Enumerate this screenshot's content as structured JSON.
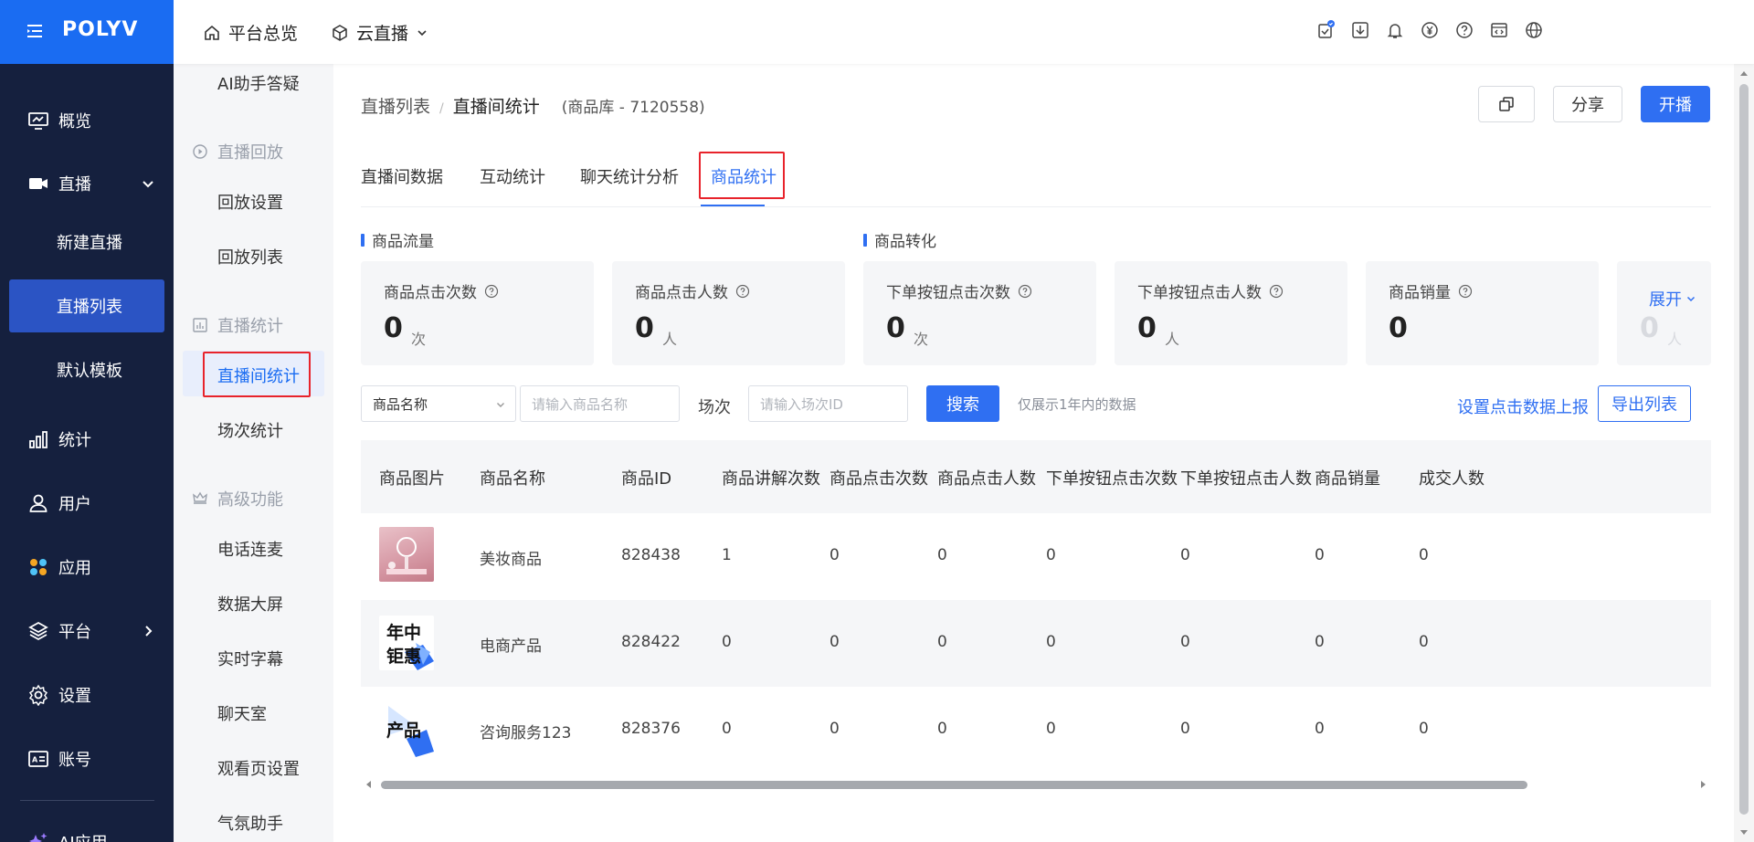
{
  "brand": {
    "logo": "POLYV"
  },
  "topnav": {
    "overview": "平台总览",
    "cloud_live": "云直播"
  },
  "sidebar": {
    "items": [
      {
        "label": "概览"
      },
      {
        "label": "直播"
      },
      {
        "label": "统计"
      },
      {
        "label": "用户"
      },
      {
        "label": "应用"
      },
      {
        "label": "平台"
      },
      {
        "label": "设置"
      },
      {
        "label": "账号"
      },
      {
        "label": "AI应用"
      }
    ],
    "sub_items": [
      {
        "label": "新建直播"
      },
      {
        "label": "直播列表"
      },
      {
        "label": "默认模板"
      }
    ]
  },
  "submenu": {
    "top_item": "AI助手答疑",
    "groups": [
      {
        "label": "直播回放",
        "items": [
          "回放设置",
          "回放列表"
        ]
      },
      {
        "label": "直播统计",
        "items": [
          "直播间统计",
          "场次统计"
        ]
      },
      {
        "label": "高级功能",
        "items": [
          "电话连麦",
          "数据大屏",
          "实时字幕",
          "聊天室",
          "观看页设置",
          "气氛助手"
        ]
      }
    ]
  },
  "breadcrumb": {
    "parent": "直播列表",
    "separator": "/",
    "current": "直播间统计",
    "sub": "(商品库 - 7120558)"
  },
  "actions": {
    "share": "分享",
    "start": "开播"
  },
  "tabs": [
    "直播间数据",
    "互动统计",
    "聊天统计分析",
    "商品统计"
  ],
  "sections": {
    "flow": "商品流量",
    "conversion": "商品转化"
  },
  "stats": [
    {
      "label": "商品点击次数",
      "value": "0",
      "unit": "次"
    },
    {
      "label": "商品点击人数",
      "value": "0",
      "unit": "人"
    },
    {
      "label": "下单按钮点击次数",
      "value": "0",
      "unit": "次"
    },
    {
      "label": "下单按钮点击人数",
      "value": "0",
      "unit": "人"
    },
    {
      "label": "商品销量",
      "value": "0",
      "unit": ""
    },
    {
      "label": "",
      "value": "0",
      "unit": "人"
    }
  ],
  "expand": "展开",
  "filters": {
    "type_select": "商品名称",
    "name_placeholder": "请输入商品名称",
    "session_label": "场次",
    "session_placeholder": "请输入场次ID",
    "search": "搜索",
    "hint": "仅展示1年内的数据",
    "report_link": "设置点击数据上报",
    "export": "导出列表"
  },
  "table": {
    "columns": [
      "商品图片",
      "商品名称",
      "商品ID",
      "商品讲解次数",
      "商品点击次数",
      "商品点击人数",
      "下单按钮点击次数",
      "下单按钮点击人数",
      "商品销量",
      "成交人数"
    ],
    "rows": [
      {
        "thumb": "photo",
        "thumb_text": "",
        "name": "美妆商品",
        "id": "828438",
        "explain": "1",
        "clicks": "0",
        "click_users": "0",
        "order_clicks": "0",
        "order_users": "0",
        "sales": "0",
        "deal_users": "0"
      },
      {
        "thumb": "text",
        "thumb_text": "年中钜惠",
        "name": "电商产品",
        "id": "828422",
        "explain": "0",
        "clicks": "0",
        "click_users": "0",
        "order_clicks": "0",
        "order_users": "0",
        "sales": "0",
        "deal_users": "0"
      },
      {
        "thumb": "text",
        "thumb_text": "产品",
        "name": "咨询服务123",
        "id": "828376",
        "explain": "0",
        "clicks": "0",
        "click_users": "0",
        "order_clicks": "0",
        "order_users": "0",
        "sales": "0",
        "deal_users": "0"
      }
    ]
  },
  "colors": {
    "brand": "#1a6cf2",
    "sidebar_bg": "#15203e",
    "accent": "#2f6ff2",
    "highlight": "#e8232b"
  }
}
